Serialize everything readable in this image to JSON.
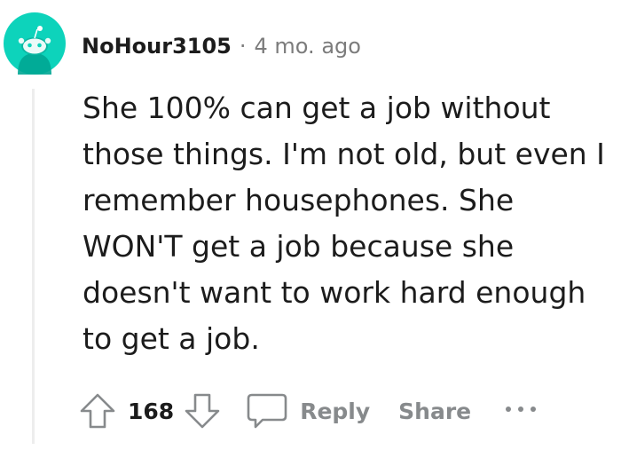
{
  "comment": {
    "username": "NoHour3105",
    "separator": "·",
    "timestamp": "4 mo. ago",
    "body": "She 100% can get a job without those things. I'm not old, but even I remember housephones. She WON'T get a job because she doesn't want to work hard enough to get a job.",
    "avatar_color": "#0dd3bb"
  },
  "actions": {
    "upvote_icon": "arrow-up-icon",
    "vote_count": "168",
    "downvote_icon": "arrow-down-icon",
    "reply_icon": "speech-bubble-icon",
    "reply_label": "Reply",
    "share_label": "Share",
    "more_icon": "ellipsis-icon"
  }
}
